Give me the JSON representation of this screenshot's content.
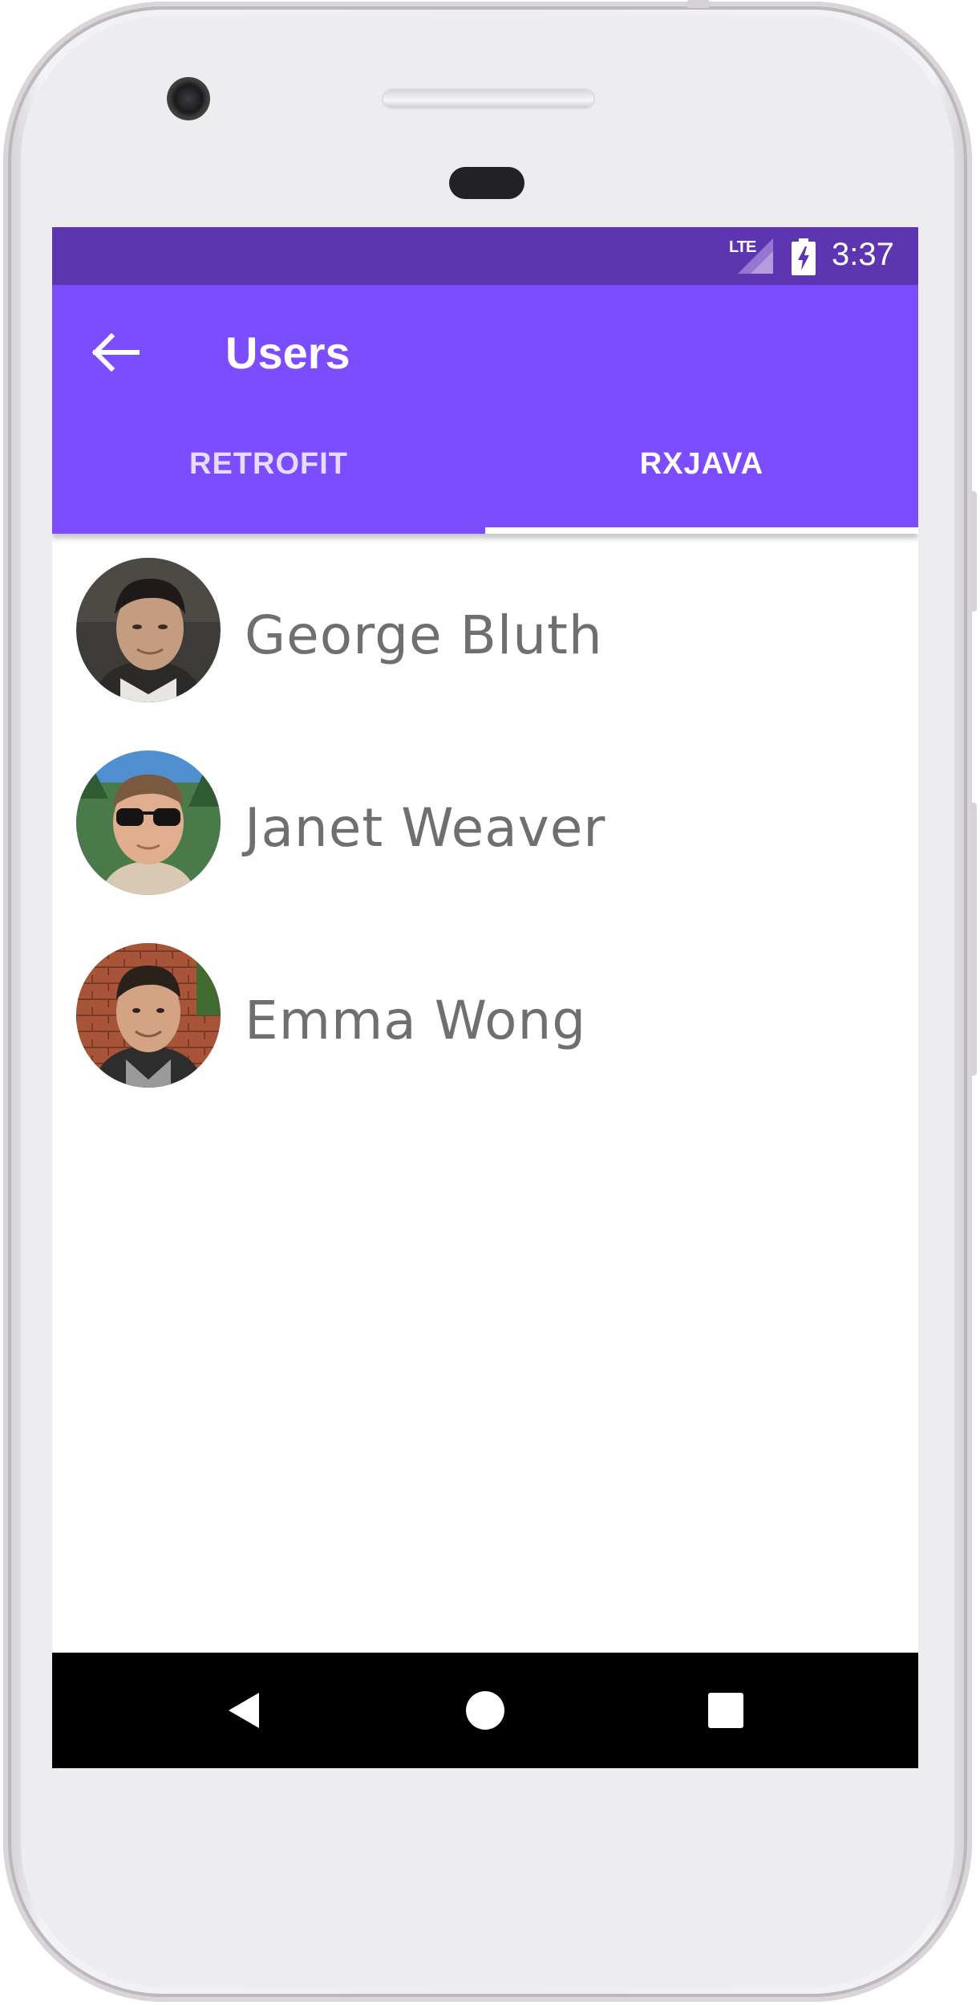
{
  "status_bar": {
    "network": "LTE",
    "time": "3:37",
    "icons": [
      "lte-signal-icon",
      "battery-charging-icon"
    ]
  },
  "app_bar": {
    "title": "Users",
    "back_icon": "arrow-back-icon"
  },
  "tabs": [
    {
      "label": "RETROFIT",
      "selected": false
    },
    {
      "label": "RXJAVA",
      "selected": true
    }
  ],
  "users": [
    {
      "name": "George Bluth"
    },
    {
      "name": "Janet Weaver"
    },
    {
      "name": "Emma Wong"
    }
  ],
  "nav_bar": {
    "icons": [
      "back-triangle-icon",
      "home-circle-icon",
      "recents-square-icon"
    ]
  },
  "colors": {
    "status_bar": "#5e35b1",
    "primary": "#7c4dff",
    "text_name": "#6f6f6f",
    "nav_bar": "#000000"
  }
}
